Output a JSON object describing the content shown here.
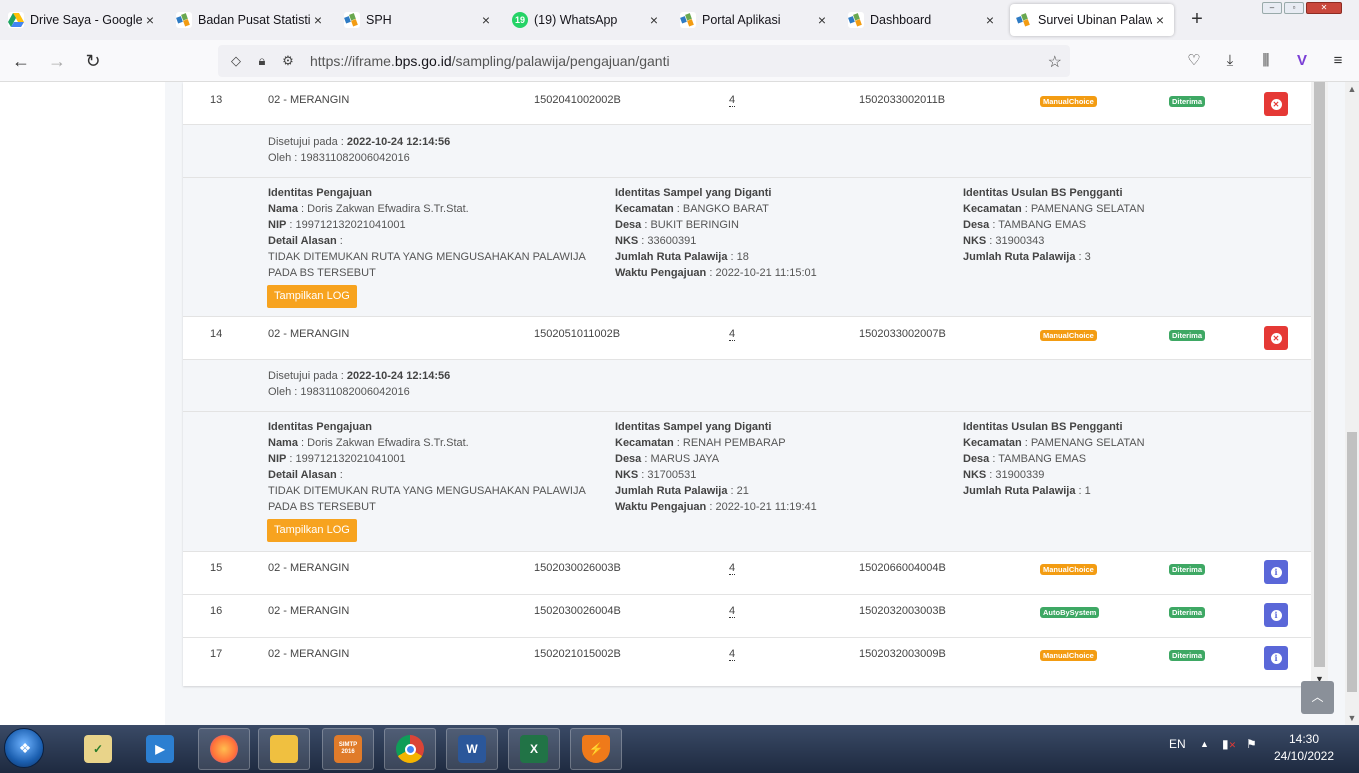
{
  "browser": {
    "tabs": [
      {
        "title": "Drive Saya - Google D",
        "icon": "google-drive-icon",
        "color": "#1fa463"
      },
      {
        "title": "Badan Pusat Statistik",
        "icon": "bps-icon",
        "color": "#2e7bc4"
      },
      {
        "title": "SPH",
        "icon": "bps-icon",
        "color": "#2e7bc4"
      },
      {
        "title": "(19) WhatsApp",
        "icon": "whatsapp-icon",
        "color": "#25d366",
        "badge": "19"
      },
      {
        "title": "Portal Aplikasi",
        "icon": "bps-icon",
        "color": "#2e7bc4"
      },
      {
        "title": "Dashboard",
        "icon": "bps-icon",
        "color": "#2e7bc4"
      },
      {
        "title": "Survei Ubinan Palawija",
        "icon": "bps-icon",
        "color": "#2e7bc4",
        "active": true
      }
    ],
    "url_prefix": "https://iframe.",
    "url_domain": "bps.go.id",
    "url_path": "/sampling/palawija/pengajuan/ganti"
  },
  "table": {
    "rows": [
      {
        "no": "13",
        "wilayah": "02 - MERANGIN",
        "nbs_lama": "1502041002002B",
        "jumlah": "4",
        "nbs_baru": "1502033002011B",
        "jenis": "ManualChoice",
        "status": "Diterima",
        "action": "delete",
        "detail": {
          "disetujui_label": "Disetujui pada :",
          "disetujui": "2022-10-24 12:14:56",
          "oleh_label": "Oleh :",
          "oleh": "198311082006042016",
          "pengajuan": {
            "title": "Identitas Pengajuan",
            "nama_label": "Nama",
            "nama": "Doris Zakwan Efwadira S.Tr.Stat.",
            "nip_label": "NIP",
            "nip": "199712132021041001",
            "alasan_label": "Detail Alasan",
            "alasan_1": "TIDAK DITEMUKAN RUTA YANG MENGUSAHAKAN PALAWIJA",
            "alasan_2": "PADA BS TERSEBUT"
          },
          "diganti": {
            "title": "Identitas Sampel yang Diganti",
            "kecamatan_label": "Kecamatan",
            "kecamatan": "BANGKO BARAT",
            "desa_label": "Desa",
            "desa": "BUKIT BERINGIN",
            "nks_label": "NKS",
            "nks": "33600391",
            "ruta_label": "Jumlah Ruta Palawija",
            "ruta": "18",
            "waktu_label": "Waktu Pengajuan",
            "waktu": "2022-10-21 11:15:01"
          },
          "usulan": {
            "title": "Identitas Usulan BS Pengganti",
            "kecamatan_label": "Kecamatan",
            "kecamatan": "PAMENANG SELATAN",
            "desa_label": "Desa",
            "desa": "TAMBANG EMAS",
            "nks_label": "NKS",
            "nks": "31900343",
            "ruta_label": "Jumlah Ruta Palawija",
            "ruta": "3"
          },
          "log_button": "Tampilkan LOG"
        }
      },
      {
        "no": "14",
        "wilayah": "02 - MERANGIN",
        "nbs_lama": "1502051011002B",
        "jumlah": "4",
        "nbs_baru": "1502033002007B",
        "jenis": "ManualChoice",
        "status": "Diterima",
        "action": "delete",
        "detail": {
          "disetujui_label": "Disetujui pada :",
          "disetujui": "2022-10-24 12:14:56",
          "oleh_label": "Oleh :",
          "oleh": "198311082006042016",
          "pengajuan": {
            "title": "Identitas Pengajuan",
            "nama_label": "Nama",
            "nama": "Doris Zakwan Efwadira S.Tr.Stat.",
            "nip_label": "NIP",
            "nip": "199712132021041001",
            "alasan_label": "Detail Alasan",
            "alasan_1": "TIDAK DITEMUKAN RUTA YANG MENGUSAHAKAN PALAWIJA",
            "alasan_2": "PADA BS TERSEBUT"
          },
          "diganti": {
            "title": "Identitas Sampel yang Diganti",
            "kecamatan_label": "Kecamatan",
            "kecamatan": "RENAH PEMBARAP",
            "desa_label": "Desa",
            "desa": "MARUS JAYA",
            "nks_label": "NKS",
            "nks": "31700531",
            "ruta_label": "Jumlah Ruta Palawija",
            "ruta": "21",
            "waktu_label": "Waktu Pengajuan",
            "waktu": "2022-10-21 11:19:41"
          },
          "usulan": {
            "title": "Identitas Usulan BS Pengganti",
            "kecamatan_label": "Kecamatan",
            "kecamatan": "PAMENANG SELATAN",
            "desa_label": "Desa",
            "desa": "TAMBANG EMAS",
            "nks_label": "NKS",
            "nks": "31900339",
            "ruta_label": "Jumlah Ruta Palawija",
            "ruta": "1"
          },
          "log_button": "Tampilkan LOG"
        }
      },
      {
        "no": "15",
        "wilayah": "02 - MERANGIN",
        "nbs_lama": "1502030026003B",
        "jumlah": "4",
        "nbs_baru": "1502066004004B",
        "jenis": "ManualChoice",
        "status": "Diterima",
        "action": "info"
      },
      {
        "no": "16",
        "wilayah": "02 - MERANGIN",
        "nbs_lama": "1502030026004B",
        "jumlah": "4",
        "nbs_baru": "1502032003003B",
        "jenis": "AutoBySystem",
        "status": "Diterima",
        "action": "info"
      },
      {
        "no": "17",
        "wilayah": "02 - MERANGIN",
        "nbs_lama": "1502021015002B",
        "jumlah": "4",
        "nbs_baru": "1502032003009B",
        "jenis": "ManualChoice",
        "status": "Diterima",
        "action": "info"
      }
    ]
  },
  "colors": {
    "manual": "#f39c12",
    "auto": "#3ea864",
    "status": "#3ea864",
    "delete": "#e53935",
    "info": "#5a67d8",
    "log": "#f7a31f"
  },
  "taskbar": {
    "apps": [
      {
        "name": "notepad-checklist-icon",
        "color": "#e9d48a",
        "label": ""
      },
      {
        "name": "media-player-icon",
        "color": "#2c7fd1",
        "label": ""
      },
      {
        "name": "firefox-icon",
        "color": "#ff7139",
        "label": ""
      },
      {
        "name": "file-explorer-icon",
        "color": "#f0c040",
        "label": ""
      },
      {
        "name": "simtp-icon",
        "color": "#e07b2a",
        "label": "SIMTP 2016"
      },
      {
        "name": "chrome-icon",
        "color": "#db4437",
        "label": ""
      },
      {
        "name": "word-icon",
        "color": "#2b579a",
        "label": "W"
      },
      {
        "name": "excel-icon",
        "color": "#217346",
        "label": "X"
      },
      {
        "name": "vpn-shield-icon",
        "color": "#ef7a1a",
        "label": ""
      }
    ],
    "lang": "EN",
    "time": "14:30",
    "date": "24/10/2022"
  }
}
